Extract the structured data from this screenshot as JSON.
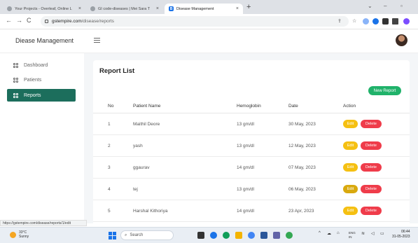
{
  "browser": {
    "tabs": [
      {
        "label": "Your Projects - Overleaf, Online L"
      },
      {
        "label": "GI code-diseases | Mei Sara T"
      },
      {
        "label": "Disease Management",
        "active": true
      }
    ],
    "new_tab": "+",
    "url_host": "gstempire.com",
    "url_path": "/disease/reports",
    "status_url": "https://gstempire.com/disease/reports/1/edit"
  },
  "app": {
    "brand": "Diease Management"
  },
  "sidebar": {
    "items": [
      {
        "label": "Dashboard",
        "active": false
      },
      {
        "label": "Patients",
        "active": false
      },
      {
        "label": "Reports",
        "active": true
      }
    ]
  },
  "report": {
    "title": "Report List",
    "new_button": "New Report",
    "columns": {
      "no": "No",
      "name": "Patient Name",
      "hb": "Hemoglobin",
      "date": "Date",
      "action": "Action"
    },
    "edit_label": "Edit",
    "delete_label": "Delete",
    "rows": [
      {
        "no": "1",
        "name": "Maithil Deore",
        "hb": "13 gm/dl",
        "date": "30 May, 2023"
      },
      {
        "no": "2",
        "name": "yash",
        "hb": "13 gm/dl",
        "date": "12 May, 2023"
      },
      {
        "no": "3",
        "name": "ggaurav",
        "hb": "14 gm/dl",
        "date": "07 May, 2023"
      },
      {
        "no": "4",
        "name": "tej",
        "hb": "13 gm/dl",
        "date": "06 May, 2023"
      },
      {
        "no": "5",
        "name": "Harshal Kithoriya",
        "hb": "14 gm/dl",
        "date": "23 Apr, 2023"
      }
    ]
  },
  "taskbar": {
    "temp": "33°C",
    "weather": "Sunny",
    "search": "Search",
    "lang1": "ENG",
    "lang2": "IN",
    "time": "06:44",
    "date": "31-05-2023"
  },
  "colors": {
    "sidebar_active": "#1c6e5c",
    "new_report": "#20b26a",
    "edit": "#f5c012",
    "delete": "#ef3c4a"
  }
}
